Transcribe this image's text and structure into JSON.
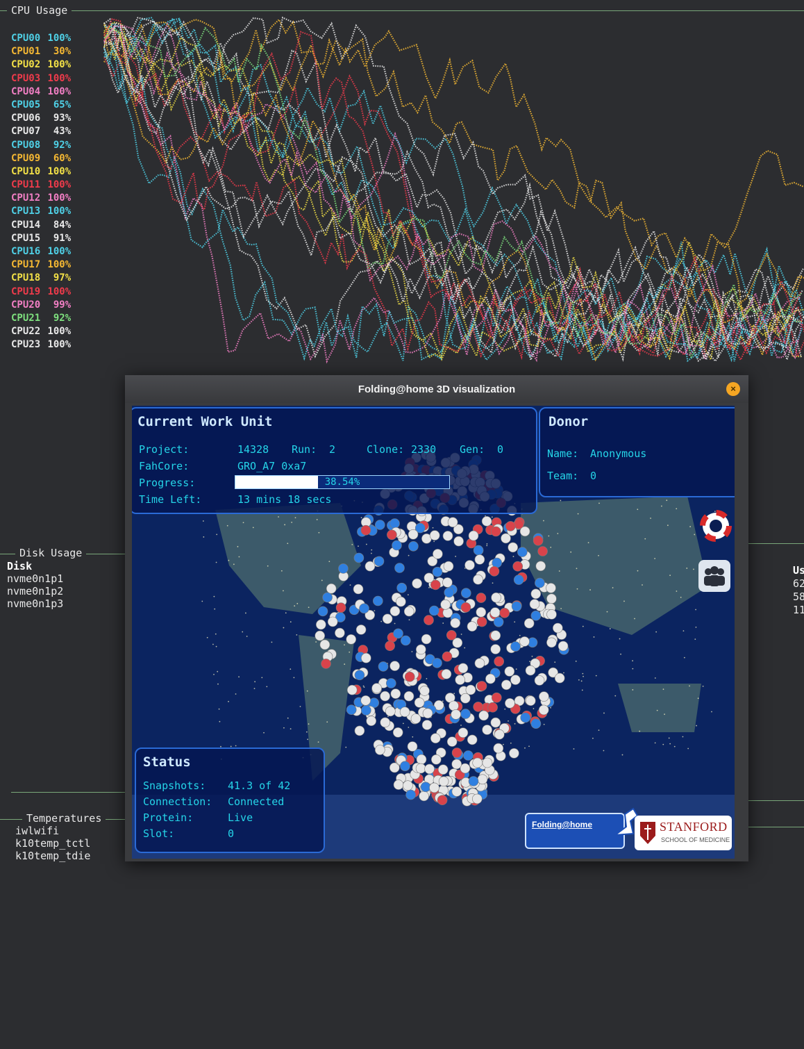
{
  "cpu_section": {
    "title": "CPU Usage",
    "cpus": [
      {
        "label": "CPU00",
        "value": "100%",
        "color": "#4fd0e6"
      },
      {
        "label": "CPU01",
        "value": "30%",
        "color": "#f5b833"
      },
      {
        "label": "CPU02",
        "value": "100%",
        "color": "#f2e047"
      },
      {
        "label": "CPU03",
        "value": "100%",
        "color": "#ef3b4b"
      },
      {
        "label": "CPU04",
        "value": "100%",
        "color": "#f27fc4"
      },
      {
        "label": "CPU05",
        "value": "65%",
        "color": "#4fd0e6"
      },
      {
        "label": "CPU06",
        "value": "93%",
        "color": "#e8e8e8"
      },
      {
        "label": "CPU07",
        "value": "43%",
        "color": "#e8e8e8"
      },
      {
        "label": "CPU08",
        "value": "92%",
        "color": "#4fd0e6"
      },
      {
        "label": "CPU09",
        "value": "60%",
        "color": "#f5b833"
      },
      {
        "label": "CPU10",
        "value": "100%",
        "color": "#f2e047"
      },
      {
        "label": "CPU11",
        "value": "100%",
        "color": "#ef3b4b"
      },
      {
        "label": "CPU12",
        "value": "100%",
        "color": "#f27fc4"
      },
      {
        "label": "CPU13",
        "value": "100%",
        "color": "#4fd0e6"
      },
      {
        "label": "CPU14",
        "value": "84%",
        "color": "#e8e8e8"
      },
      {
        "label": "CPU15",
        "value": "91%",
        "color": "#e8e8e8"
      },
      {
        "label": "CPU16",
        "value": "100%",
        "color": "#4fd0e6"
      },
      {
        "label": "CPU17",
        "value": "100%",
        "color": "#f5b833"
      },
      {
        "label": "CPU18",
        "value": "97%",
        "color": "#f2e047"
      },
      {
        "label": "CPU19",
        "value": "100%",
        "color": "#ef3b4b"
      },
      {
        "label": "CPU20",
        "value": "99%",
        "color": "#f27fc4"
      },
      {
        "label": "CPU21",
        "value": "92%",
        "color": "#7ee07e"
      },
      {
        "label": "CPU22",
        "value": "100%",
        "color": "#e8e8e8"
      },
      {
        "label": "CPU23",
        "value": "100%",
        "color": "#e8e8e8"
      }
    ]
  },
  "disk_section": {
    "title": "Disk Usage",
    "header": "Disk",
    "disks": [
      "nvme0n1p1",
      "nvme0n1p2",
      "nvme0n1p3"
    ],
    "right_column": [
      "Us",
      "62",
      "58",
      "11"
    ]
  },
  "temp_section": {
    "title": "Temperatures",
    "sensors": [
      "iwlwifi",
      "k10temp_tctl",
      "k10temp_tdie"
    ]
  },
  "fah": {
    "window_title": "Folding@home 3D visualization",
    "close_symbol": "×",
    "work_unit": {
      "title": "Current Work Unit",
      "project_label": "Project:",
      "project_value": "14328",
      "run_label": "Run:",
      "run_value": "2",
      "clone_label": "Clone:",
      "clone_value": "2330",
      "gen_label": "Gen:",
      "gen_value": "0",
      "fahcore_label": "FahCore:",
      "fahcore_value": "GRO_A7 0xa7",
      "progress_label": "Progress:",
      "progress_text": "38.54%",
      "progress_fraction": 0.3854,
      "time_label": "Time Left:",
      "time_value": "13 mins 18 secs"
    },
    "donor": {
      "title": "Donor",
      "name_label": "Name:",
      "name_value": "Anonymous",
      "team_label": "Team:",
      "team_value": "0"
    },
    "status": {
      "title": "Status",
      "snapshots_label": "Snapshots:",
      "snapshots_value": "41.3 of 42",
      "connection_label": "Connection:",
      "connection_value": "Connected",
      "protein_label": "Protein:",
      "protein_value": "Live",
      "slot_label": "Slot:",
      "slot_value": "0"
    },
    "logo_fah": "Folding@home",
    "logo_stanford": "STANFORD",
    "logo_stanford_sub": "SCHOOL OF MEDICINE",
    "icons": [
      "lifebuoy-icon",
      "team-icon"
    ]
  }
}
